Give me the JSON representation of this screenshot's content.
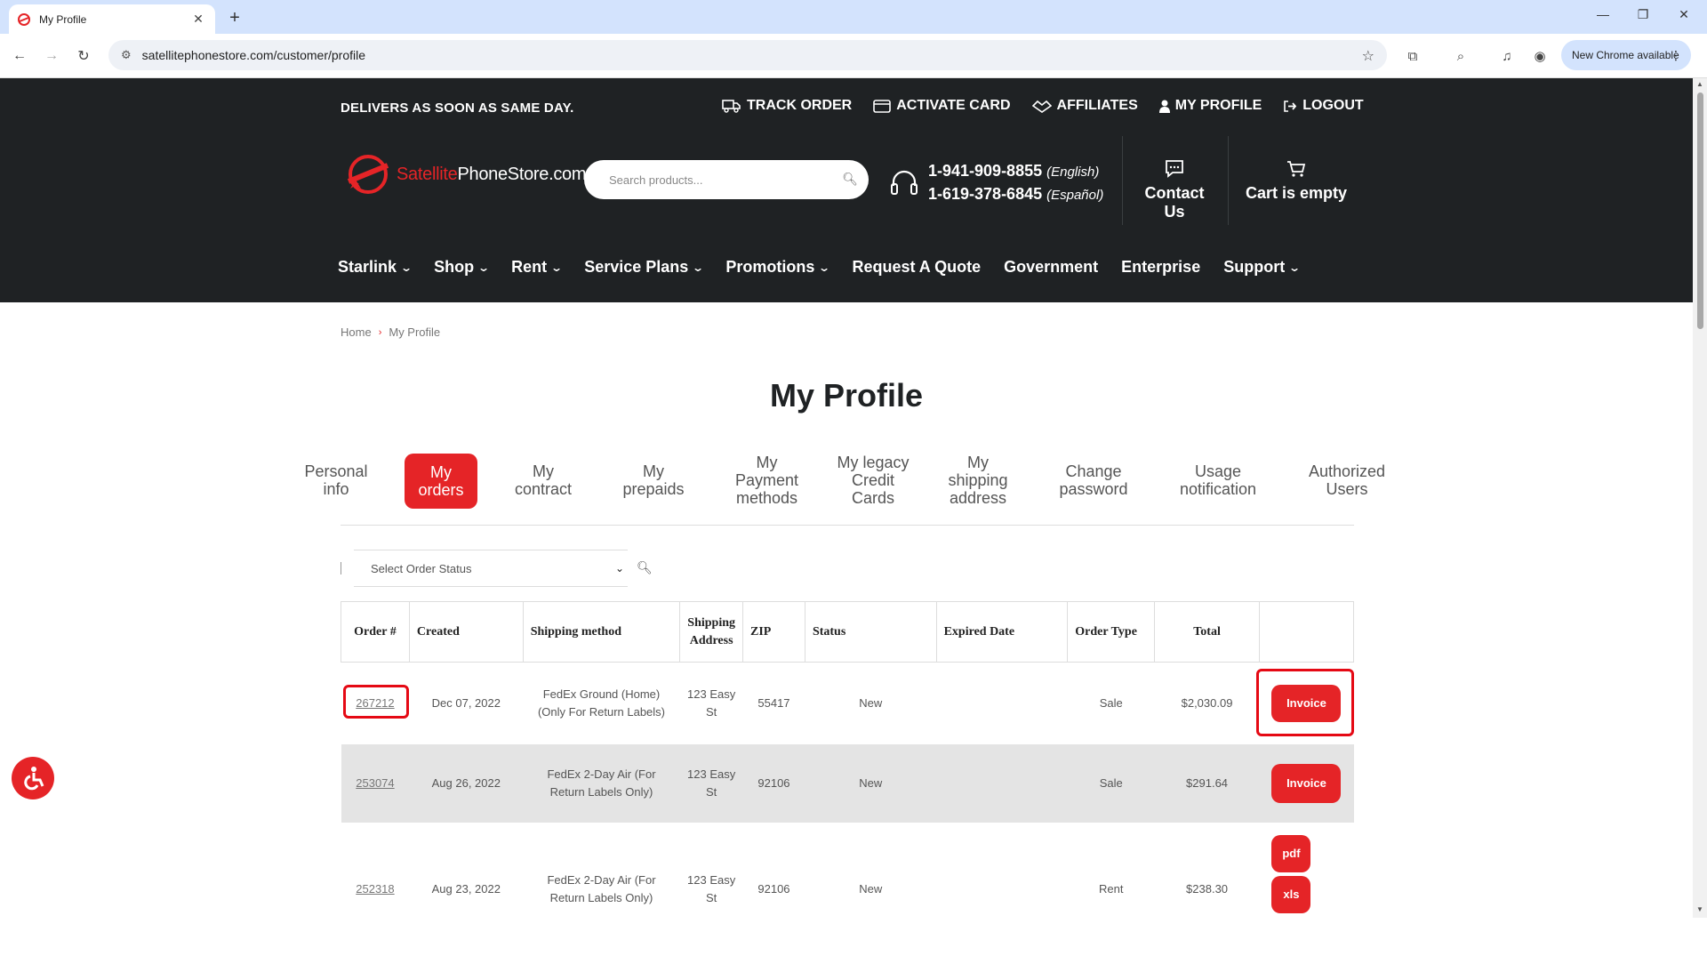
{
  "browser": {
    "tab_title": "My Profile",
    "url": "satellitephonestore.com/customer/profile",
    "chrome_update": "New Chrome available"
  },
  "header": {
    "tagline": "DELIVERS AS SOON AS SAME DAY.",
    "top_links": [
      "TRACK ORDER",
      "ACTIVATE CARD",
      "AFFILIATES",
      "MY PROFILE",
      "LOGOUT"
    ],
    "logo_part1": "Satellite",
    "logo_part2": "PhoneStore.com",
    "search_placeholder": "Search products...",
    "phone_en": "1-941-909-8855",
    "phone_en_lang": "(English)",
    "phone_es": "1-619-378-6845",
    "phone_es_lang": "(Español)",
    "contact_label": "Contact Us",
    "cart_label": "Cart is empty"
  },
  "main_nav": [
    "Starlink",
    "Shop",
    "Rent",
    "Service Plans",
    "Promotions",
    "Request A Quote",
    "Government",
    "Enterprise",
    "Support"
  ],
  "breadcrumb": {
    "home": "Home",
    "current": "My Profile"
  },
  "page_title": "My Profile",
  "profile_tabs": [
    "Personal info",
    "My orders",
    "My contract",
    "My prepaids",
    "My Payment methods",
    "My legacy Credit Cards",
    "My shipping address",
    "Change password",
    "Usage notification",
    "Authorized Users"
  ],
  "active_tab": "My orders",
  "filter": {
    "placeholder": "Select Order Status"
  },
  "table": {
    "headers": [
      "Order #",
      "Created",
      "Shipping method",
      "Shipping Address",
      "ZIP",
      "Status",
      "Expired Date",
      "Order Type",
      "Total",
      ""
    ],
    "rows": [
      {
        "order": "267212",
        "created": "Dec 07, 2022",
        "shipping": "FedEx Ground (Home) (Only For Return Labels)",
        "address": "123 Easy St",
        "zip": "55417",
        "status": "New",
        "expired": "",
        "type": "Sale",
        "total": "$2,030.09",
        "action": "Invoice"
      },
      {
        "order": "253074",
        "created": "Aug 26, 2022",
        "shipping": "FedEx 2-Day Air (For Return Labels Only)",
        "address": "123 Easy St",
        "zip": "92106",
        "status": "New",
        "expired": "",
        "type": "Sale",
        "total": "$291.64",
        "action": "Invoice"
      },
      {
        "order": "252318",
        "created": "Aug 23, 2022",
        "shipping": "FedEx 2-Day Air (For Return Labels Only)",
        "address": "123 Easy St",
        "zip": "92106",
        "status": "New",
        "expired": "",
        "type": "Rent",
        "total": "$238.30",
        "action_pdf": "pdf",
        "action_xls": "xls"
      }
    ]
  },
  "colors": {
    "brand_red": "#e52427",
    "header_bg": "#1f2224"
  }
}
